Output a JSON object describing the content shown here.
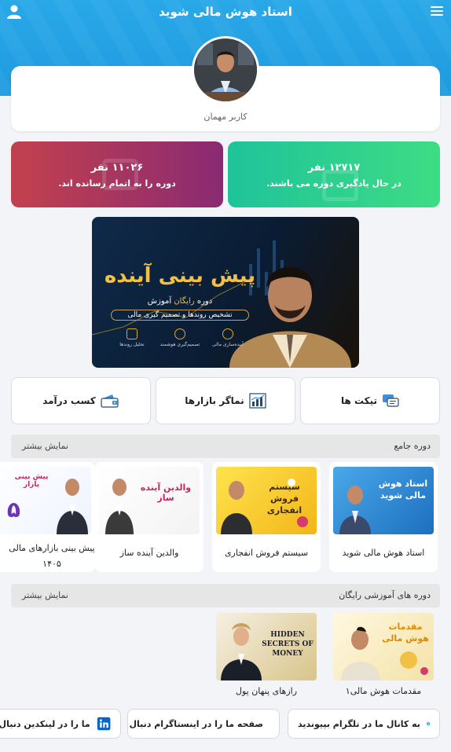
{
  "header": {
    "title": "استاد هوش مالی شوید",
    "menu_icon": "hamburger-menu-icon",
    "user_icon": "user-icon"
  },
  "profile": {
    "name": "کاربر مهمان"
  },
  "stats": [
    {
      "count": "۱۲۷۱۷ نفر",
      "desc": "در حال یادگیری دوره می باشند.",
      "color": "#2fd08e"
    },
    {
      "count": "۱۱۰۲۶ نفر",
      "desc": "دوره را به اتمام رسانده اند.",
      "color": "#a83660"
    }
  ],
  "banner": {
    "headline": "پیش بینی آینده",
    "line1_a": "دوره",
    "line1_b": "رایگان",
    "line1_c": "آموزش",
    "line2": "تشخیص روندها و تصمیم گیری مالی",
    "features": [
      "آینده‌سازی مالی",
      "تصمیم‌گیری هوشمند",
      "تحلیل روندها"
    ]
  },
  "quick_links": [
    {
      "label": "تیکت ها",
      "icon": "ticket-chat-icon"
    },
    {
      "label": "نماگر بازارها",
      "icon": "market-chart-icon"
    },
    {
      "label": "کسب درآمد",
      "icon": "wallet-icon"
    }
  ],
  "section_comprehensive": {
    "title": "دوره جامع",
    "more": "نمایش بیشتر",
    "courses": [
      {
        "title": "استاد هوش مالی شوید",
        "thumb_text": "استاد هوش مالی شوید"
      },
      {
        "title": "سیستم فروش انفجاری",
        "thumb_text": "سیستم فروش انفجاری"
      },
      {
        "title": "والدین آینده ساز",
        "thumb_text": "والدین آینده ساز"
      },
      {
        "title": "پیش بینی بازارهای مالی ۱۴۰۵",
        "thumb_text": "پیش بینی بازار"
      }
    ]
  },
  "section_free": {
    "title": "دوره های آموزشی رایگان",
    "more": "نمایش بیشتر",
    "courses": [
      {
        "title": "مقدمات هوش مالی۱",
        "thumb_text": "مقدمات هوش مالی"
      },
      {
        "title": "رازهای پنهان پول",
        "thumb_text": "HIDDEN SECRETS OF MONEY"
      }
    ]
  },
  "social": [
    {
      "label": "به کانال ما در تلگرام بپیوندید",
      "icon": "telegram-icon",
      "color": "#2aa3dd"
    },
    {
      "label": "صفحه ما را در اینستاگرام دنبال کنید",
      "icon": "instagram-icon",
      "color": "#d6307a"
    },
    {
      "label": "ما را در لینکدین دنبال کنید",
      "icon": "linkedin-icon",
      "color": "#0a66c2"
    }
  ]
}
